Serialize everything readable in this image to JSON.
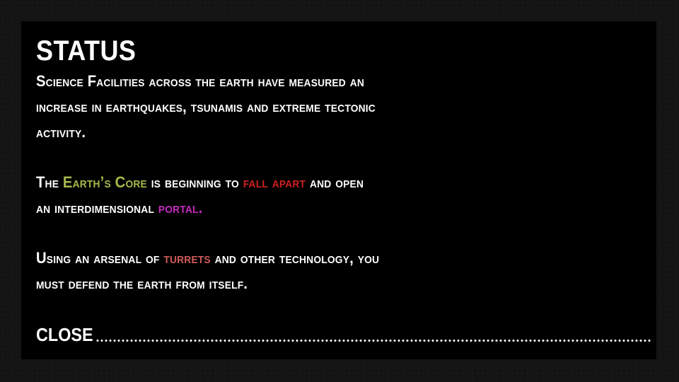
{
  "status_panel": {
    "title": "STATUS",
    "paragraph1": {
      "line1": "Science Facilities across the earth have measured an",
      "line2": "increase in earthquakes, tsunamis and extreme tectonic",
      "line3": "activity."
    },
    "paragraph2": {
      "line1_pre": "The ",
      "line1_core": "Earth’s Core",
      "line1_mid": " is beginning to ",
      "line1_fall": "fall apart",
      "line1_post": " and open",
      "line2_pre": "an interdimensional ",
      "line2_portal": "portal."
    },
    "paragraph3": {
      "line1_pre": "Using an arsenal of ",
      "line1_turrets": "turrets",
      "line1_post": " and other technology, you",
      "line2": "must defend the earth from itself."
    },
    "close_label": "CLOSE"
  },
  "colors": {
    "background": "#141414",
    "panel": "#000000",
    "text": "#ffffff",
    "earths_core": "#a9b84a",
    "fall_apart": "#d11f1f",
    "portal": "#c52bbf",
    "turrets": "#cf5a5a"
  }
}
